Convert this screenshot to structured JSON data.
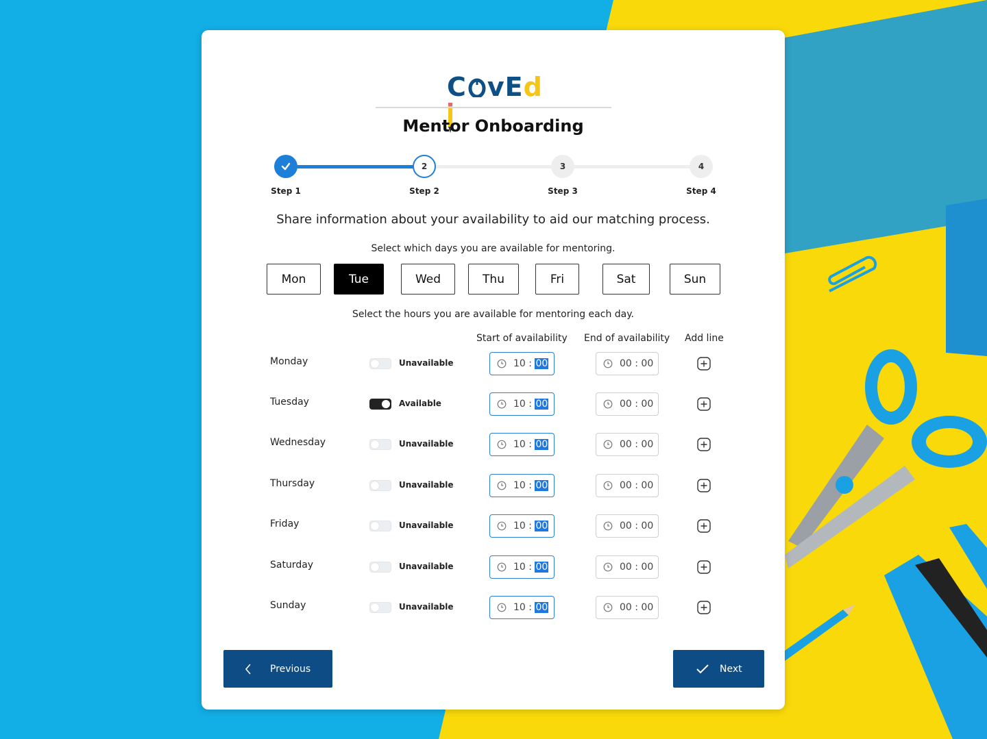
{
  "logo": {
    "text_blue": "C",
    "text_blue2": "vE",
    "text_yellow": "d",
    "alt": "CovEd"
  },
  "title": "Mentor Onboarding",
  "steps": [
    {
      "label": "Step 1",
      "number": "1",
      "state": "complete"
    },
    {
      "label": "Step 2",
      "number": "2",
      "state": "current"
    },
    {
      "label": "Step 3",
      "number": "3",
      "state": "upcoming"
    },
    {
      "label": "Step 4",
      "number": "4",
      "state": "upcoming"
    }
  ],
  "intro": "Share information about your availability to aid our matching process.",
  "days_prompt": "Select which days you are available for mentoring.",
  "day_buttons": [
    {
      "label": "Mon",
      "selected": false
    },
    {
      "label": "Tue",
      "selected": true
    },
    {
      "label": "Wed",
      "selected": false
    },
    {
      "label": "Thu",
      "selected": false
    },
    {
      "label": "Fri",
      "selected": false
    },
    {
      "label": "Sat",
      "selected": false
    },
    {
      "label": "Sun",
      "selected": false
    }
  ],
  "hours_prompt": "Select the hours you are available for mentoring each day.",
  "columns": {
    "start": "Start of availability",
    "end": "End of availability",
    "add": "Add line"
  },
  "rows": [
    {
      "day": "Monday",
      "available": false,
      "status": "Unavailable",
      "start_h": "10",
      "start_m": "00",
      "end": "00 : 00"
    },
    {
      "day": "Tuesday",
      "available": true,
      "status": "Available",
      "start_h": "10",
      "start_m": "00",
      "end": "00 : 00"
    },
    {
      "day": "Wednesday",
      "available": false,
      "status": "Unavailable",
      "start_h": "10",
      "start_m": "00",
      "end": "00 : 00"
    },
    {
      "day": "Thursday",
      "available": false,
      "status": "Unavailable",
      "start_h": "10",
      "start_m": "00",
      "end": "00 : 00"
    },
    {
      "day": "Friday",
      "available": false,
      "status": "Unavailable",
      "start_h": "10",
      "start_m": "00",
      "end": "00 : 00"
    },
    {
      "day": "Saturday",
      "available": false,
      "status": "Unavailable",
      "start_h": "10",
      "start_m": "00",
      "end": "00 : 00"
    },
    {
      "day": "Sunday",
      "available": false,
      "status": "Unavailable",
      "start_h": "10",
      "start_m": "00",
      "end": "00 : 00"
    }
  ],
  "buttons": {
    "previous": "Previous",
    "next": "Next"
  },
  "colors": {
    "brand": "#0d4c84",
    "accent": "#2a7fd4",
    "bg_blue": "#12aee6",
    "bg_yellow": "#f9d90a"
  }
}
